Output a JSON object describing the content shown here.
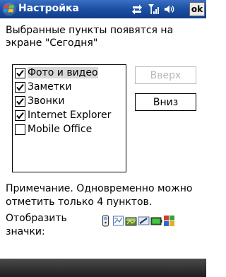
{
  "title_bar": {
    "title": "Настройка",
    "ok_label": "ok",
    "icons": [
      "windows-logo",
      "sync-icon",
      "signal-icon",
      "speaker-icon"
    ]
  },
  "instruction": "Выбранные пункты появятся на экране \"Сегодня\"",
  "list": {
    "items": [
      {
        "label": "Фото и видео",
        "checked": true,
        "selected": true
      },
      {
        "label": "Заметки",
        "checked": true,
        "selected": false
      },
      {
        "label": "Звонки",
        "checked": true,
        "selected": false
      },
      {
        "label": "Internet Explorer",
        "checked": true,
        "selected": false
      },
      {
        "label": "Mobile Office",
        "checked": false,
        "selected": false
      }
    ]
  },
  "buttons": {
    "up_label": "Вверх",
    "up_enabled": false,
    "down_label": "Вниз",
    "down_enabled": true
  },
  "note": "Примечание. Одновременно можно отметить только 4 пунктов.",
  "show_icons_label": "Отобразить значки:",
  "status_icons": [
    "phone-icon",
    "notes-icon",
    "camera-icon",
    "pen-icon",
    "battery-icon",
    "office-icon"
  ],
  "colors": {
    "title_bar": "#1c4fa3",
    "menu_bar": "#1e1e1e",
    "selection": "#d8d8d8",
    "disabled_text": "#b8b8b8"
  }
}
